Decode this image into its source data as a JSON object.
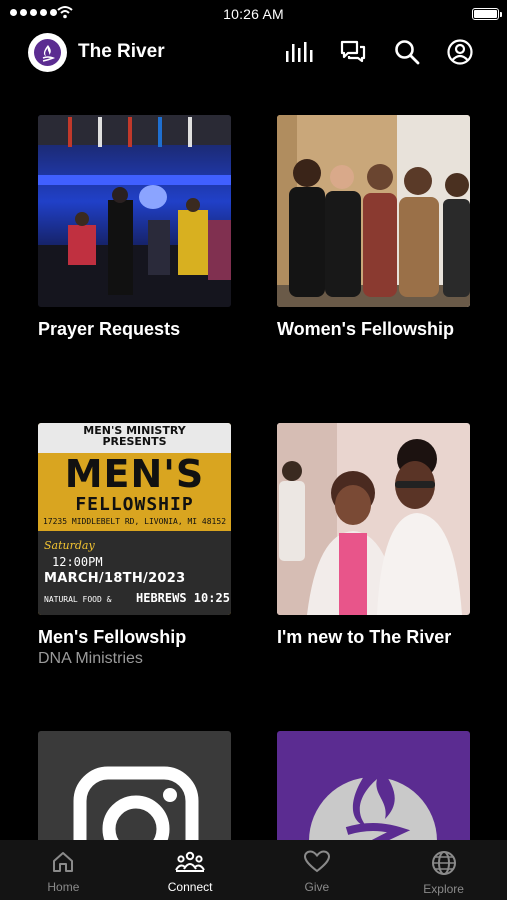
{
  "status_bar": {
    "time": "10:26 AM"
  },
  "header": {
    "title": "The River"
  },
  "cards": [
    {
      "title": "Prayer Requests",
      "subtitle": ""
    },
    {
      "title": "Women's Fellowship",
      "subtitle": ""
    },
    {
      "title": "Men's Fellowship",
      "subtitle": "DNA Ministries"
    },
    {
      "title": "I'm new to The River",
      "subtitle": ""
    },
    {
      "title": "",
      "subtitle": ""
    },
    {
      "title": "",
      "subtitle": ""
    }
  ],
  "flyer": {
    "ministry": "MEN'S MINISTRY",
    "presents": "PRESENTS",
    "heading": "MEN'S",
    "subheading": "FELLOWSHIP",
    "address": "17235 MIDDLEBELT RD, LIVONIA, MI 48152",
    "day": "Saturday",
    "time": "12:00PM",
    "date": "MARCH/18TH/2023",
    "food": "NATURAL FOOD &",
    "verse": "HEBREWS 10:25"
  },
  "nav": [
    {
      "label": "Home",
      "icon": "home-icon"
    },
    {
      "label": "Connect",
      "icon": "people-icon"
    },
    {
      "label": "Give",
      "icon": "heart-icon"
    },
    {
      "label": "Explore",
      "icon": "globe-icon"
    }
  ],
  "colors": {
    "accent_purple": "#5b2c91",
    "flyer_yellow": "#d9a520",
    "nav_bg": "#141414"
  }
}
